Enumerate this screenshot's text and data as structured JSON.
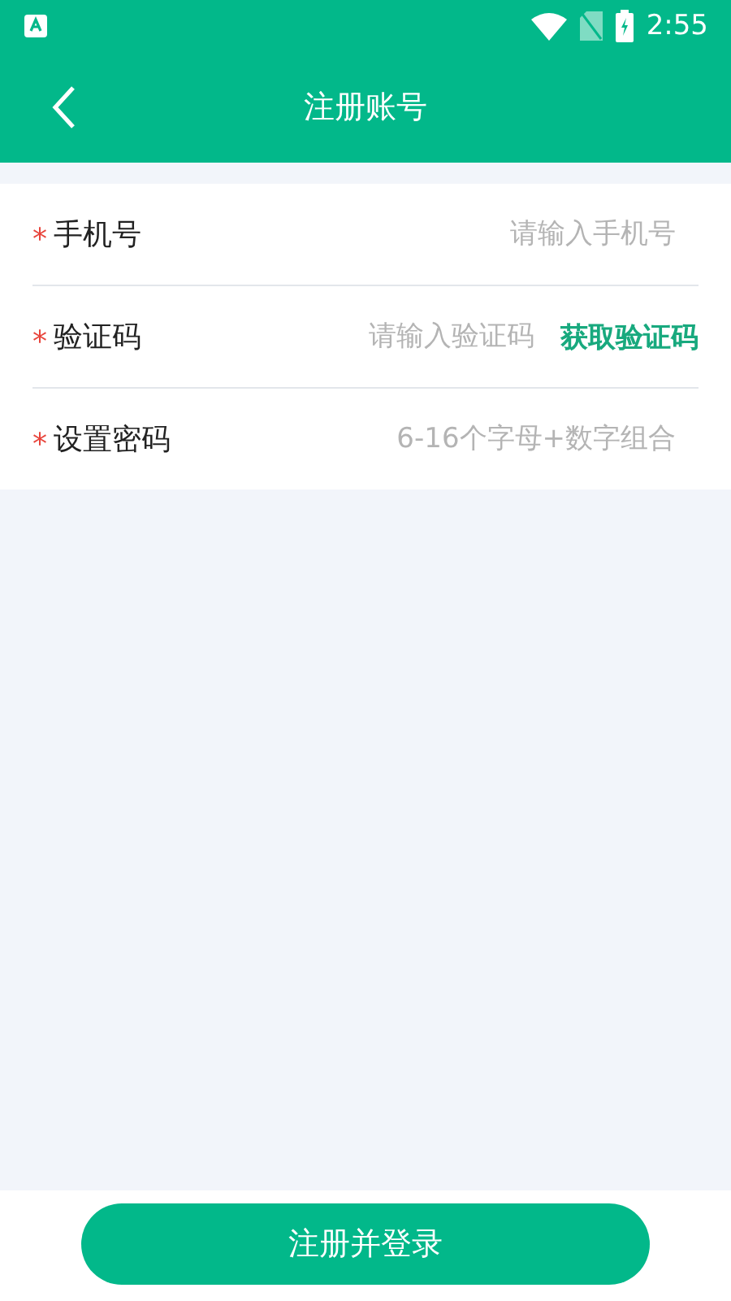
{
  "status_bar": {
    "time": "2:55"
  },
  "header": {
    "title": "注册账号"
  },
  "form": {
    "rows": [
      {
        "kind": "input",
        "marker": "*",
        "label": "手机号",
        "placeholder": "请输入手机号"
      },
      {
        "kind": "code",
        "marker": "*",
        "label": "验证码",
        "placeholder": "请输入验证码",
        "action": "获取验证码"
      },
      {
        "kind": "password",
        "marker": "*",
        "label": "设置密码",
        "placeholder": "6-16个字母+数字组合"
      }
    ]
  },
  "submit": {
    "label": "注册并登录"
  }
}
